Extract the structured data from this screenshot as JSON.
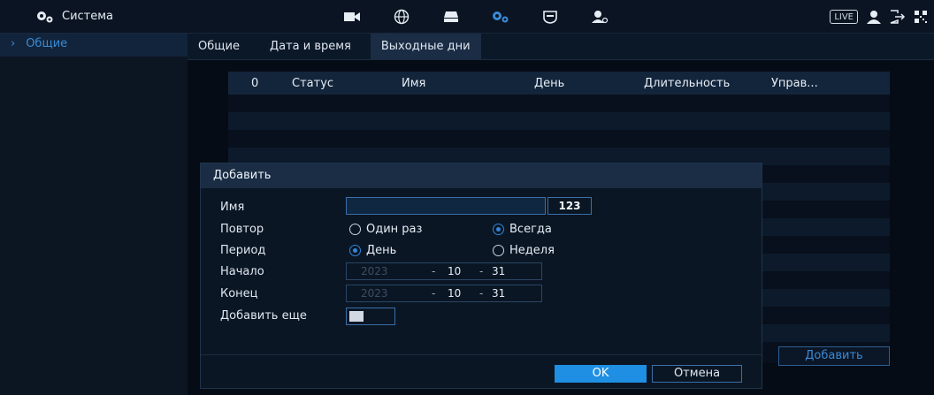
{
  "topbar": {
    "title": "Система",
    "icons": [
      "camera-icon",
      "network-icon",
      "storage-icon",
      "system-settings-icon",
      "security-shield-icon",
      "account-icon"
    ],
    "live_label": "LIVE"
  },
  "sidebar": {
    "items": [
      {
        "label": "Общие",
        "chevron": "›"
      }
    ]
  },
  "tabs": [
    {
      "label": "Общие"
    },
    {
      "label": "Дата и время"
    },
    {
      "label": "Выходные дни",
      "active": true
    }
  ],
  "table": {
    "columns": {
      "index": "0",
      "status": "Статус",
      "name": "Имя",
      "day": "День",
      "duration": "Длительность",
      "manage": "Управ..."
    }
  },
  "outer_add_button": "Добавить",
  "dialog": {
    "title": "Добавить",
    "name_label": "Имя",
    "name_value": "",
    "keyboard_button": "123",
    "repeat_label": "Повтор",
    "repeat_options": [
      "Один раз",
      "Всегда"
    ],
    "repeat_selected": "Всегда",
    "period_label": "Период",
    "period_options": [
      "День",
      "Неделя"
    ],
    "period_selected": "День",
    "start_label": "Начало",
    "start_date": {
      "year": "2023",
      "month": "10",
      "day": "31",
      "sep": "-"
    },
    "end_label": "Конец",
    "end_date": {
      "year": "2023",
      "month": "10",
      "day": "31",
      "sep": "-"
    },
    "add_more_label": "Добавить еще",
    "ok_label": "OK",
    "cancel_label": "Отмена"
  },
  "colors": {
    "accent": "#1f8fe3",
    "highlight": "#3a8ad6"
  }
}
